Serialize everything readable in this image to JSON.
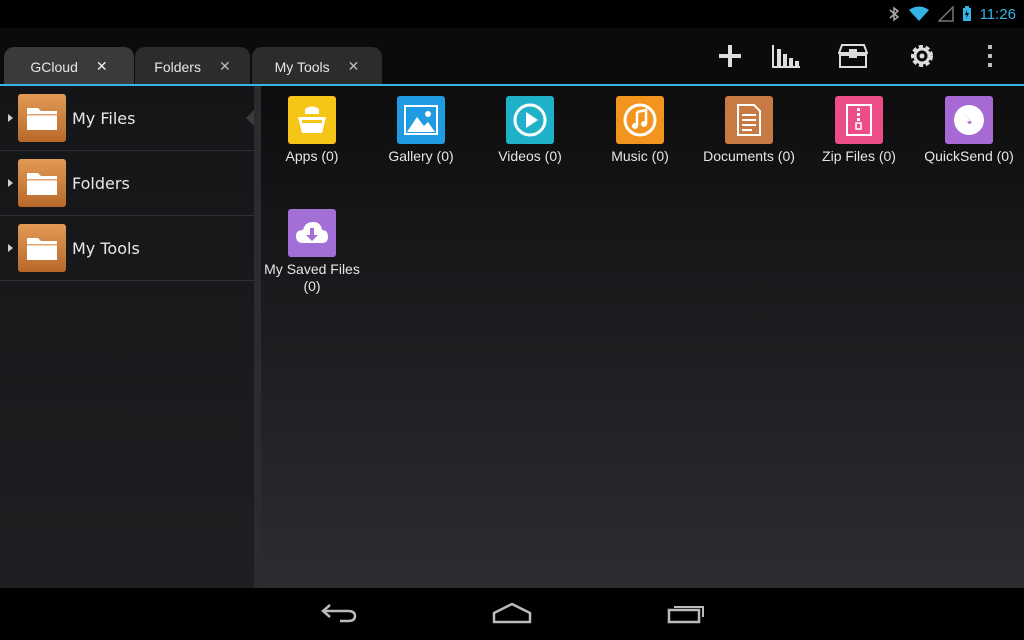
{
  "status_bar": {
    "time": "11:26"
  },
  "tabs": [
    {
      "label": "GCloud",
      "close": "✕",
      "active": true
    },
    {
      "label": "Folders",
      "close": "✕",
      "active": false
    },
    {
      "label": "My Tools",
      "close": "✕",
      "active": false
    }
  ],
  "toolbar": {
    "icons": [
      "add-icon",
      "bar-chart-icon",
      "toolbox-icon",
      "gear-icon",
      "overflow-menu-icon"
    ]
  },
  "sidebar": {
    "items": [
      {
        "label": "My Files",
        "icon": "folder-icon",
        "selected": true
      },
      {
        "label": "Folders",
        "icon": "folder-icon",
        "selected": false
      },
      {
        "label": "My Tools",
        "icon": "folder-icon",
        "selected": false
      }
    ]
  },
  "main": {
    "tiles": [
      {
        "caption": "Apps (0)",
        "icon": "apps-icon",
        "color": "#f5c518"
      },
      {
        "caption": "Gallery (0)",
        "icon": "gallery-icon",
        "color": "#1e9be2"
      },
      {
        "caption": "Videos (0)",
        "icon": "videos-icon",
        "color": "#1fb1c8"
      },
      {
        "caption": "Music (0)",
        "icon": "music-icon",
        "color": "#f2941d"
      },
      {
        "caption": "Documents (0)",
        "icon": "documents-icon",
        "color": "#c87a45"
      },
      {
        "caption": "Zip Files (0)",
        "icon": "zip-icon",
        "color": "#ec4c88"
      },
      {
        "caption": "QuickSend (0)",
        "icon": "quicksend-icon",
        "color": "#a769d3"
      },
      {
        "caption_line1": "My Saved Files",
        "caption_line2": "(0)",
        "icon": "cloud-download-icon",
        "color": "#a36fd6"
      }
    ]
  },
  "colors": {
    "accent": "#33b5e5",
    "folder": "#d38645"
  },
  "nav_bar": {
    "icons": [
      "back-icon",
      "home-icon",
      "recents-icon"
    ]
  }
}
